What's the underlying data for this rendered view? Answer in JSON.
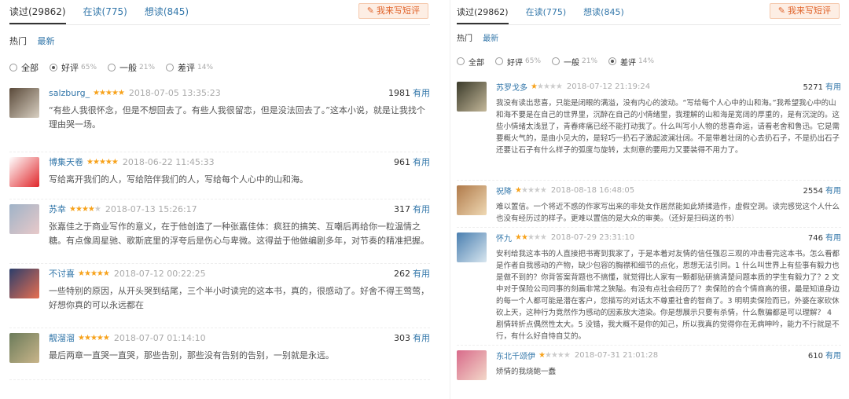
{
  "left": {
    "tabs": [
      {
        "label": "读过(29862)",
        "active": true
      },
      {
        "label": "在读(775)",
        "active": false
      },
      {
        "label": "想读(845)",
        "active": false
      }
    ],
    "write_button": "我来写短评",
    "sort": {
      "hot": "热门",
      "newest": "最新"
    },
    "filters": [
      {
        "label": "全部",
        "pct": "",
        "selected": false
      },
      {
        "label": "好评",
        "pct": "65%",
        "selected": true
      },
      {
        "label": "一般",
        "pct": "21%",
        "selected": false
      },
      {
        "label": "差评",
        "pct": "14%",
        "selected": false
      }
    ],
    "comments": [
      {
        "user": "salzburg_",
        "rating": 5,
        "date": "2018-07-05 13:35:23",
        "votes": "1981",
        "useful": "有用",
        "text": "“有些人我很怀念，但是不想回去了。有些人我很留恋，但是没法回去了。”这本小说，就是让我找个理由哭一场。",
        "avatar_colors": [
          "#5a4a3a",
          "#d9d0c2"
        ]
      },
      {
        "user": "博集天卷",
        "rating": 5,
        "date": "2018-06-22 11:45:33",
        "votes": "961",
        "useful": "有用",
        "text": "写给离开我们的人，写给陪伴我们的人，写给每个人心中的山和海。",
        "avatar_colors": [
          "#ffffff",
          "#e0262a"
        ]
      },
      {
        "user": "苏幸",
        "rating": 4,
        "date": "2018-07-13 15:26:17",
        "votes": "317",
        "useful": "有用",
        "text": "张嘉佳之于商业写作的意义，在于他创造了一种张嘉佳体：疯狂的搞笑、互嘲后再给你一粒温情之糖。有点像周星驰、歌斯底里的浮夸后是伤心与卑微。这得益于他做编剧多年，对节奏的精准把握。",
        "avatar_colors": [
          "#9fb3c8",
          "#e8c9c9"
        ]
      },
      {
        "user": "不讨喜",
        "rating": 5,
        "date": "2018-07-12 00:22:25",
        "votes": "262",
        "useful": "有用",
        "text": "一些特别的原因，从开头哭到结尾，三个半小时读完的这本书，真的，很感动了。好舍不得王莺莺，好想你真的可以永远都在",
        "avatar_colors": [
          "#2c3e6b",
          "#e76f51"
        ]
      },
      {
        "user": "靓溜溜",
        "rating": 5,
        "date": "2018-07-07 01:14:10",
        "votes": "303",
        "useful": "有用",
        "text": "最后两章一直哭一直哭，那些告别，那些没有告别的告别，一别就是永远。",
        "avatar_colors": [
          "#6b7b5a",
          "#c9b58a"
        ]
      }
    ]
  },
  "right": {
    "tabs": [
      {
        "label": "读过(29862)",
        "active": true
      },
      {
        "label": "在读(775)",
        "active": false
      },
      {
        "label": "想读(845)",
        "active": false
      }
    ],
    "write_button": "我来写短评",
    "sort": {
      "hot": "热门",
      "newest": "最新"
    },
    "filters": [
      {
        "label": "全部",
        "pct": "",
        "selected": false
      },
      {
        "label": "好评",
        "pct": "65%",
        "selected": false
      },
      {
        "label": "一般",
        "pct": "21%",
        "selected": false
      },
      {
        "label": "差评",
        "pct": "14%",
        "selected": true
      }
    ],
    "comments": [
      {
        "user": "苏罗戈多",
        "rating": 1,
        "date": "2018-07-12 21:19:24",
        "votes": "5271",
        "useful": "有用",
        "text": "我没有读出悲喜，只能是闭眼的满溢，没有内心的波动。“写给每个人心中的山和海。”我希望我心中的山和海不要是在自己的世界里，沉醉在自己的小情绪里，我理解的山和海是宽阔的厚重的，是有沉淀的。这些小情绪太浅显了，青春疼痛已经不能打动我了。什么叫写小人物的悲喜命运，请看老舍和鲁迅。它是需要概火气的，是由小见大的，是轻巧一扔石子激起波澜壮阔。不是带着壮阔的心去扔石子，不是扔出石子还要让石子有什么样子的弧度与旋转，太刻意的要用力又要装得不用力了。",
        "avatar_colors": [
          "#3a3a2a",
          "#c4b89a"
        ]
      },
      {
        "user": "祝降",
        "rating": 1,
        "date": "2018-08-18 16:48:05",
        "votes": "2554",
        "useful": "有用",
        "text": "难以置信。一个将近不惑的作家写出来的非处女作居然能如此矫揉造作，虚假空洞。读完感觉这个人什么也没有经历过的样子。更难以置信的是大众的审美。（还好是扫码送的书）",
        "avatar_colors": [
          "#b07a4a",
          "#efd9b4"
        ]
      },
      {
        "user": "怀九",
        "rating": 2,
        "date": "2018-07-29 23:31:10",
        "votes": "746",
        "useful": "有用",
        "text": "安利给我这本书的人直接把书寄到我家了，于是本着对友情的信任强忍三观的冲击看完这本书。怎么看都是作者自我感动的产物，缺少包容的胸襟和细节的点化，思想无法引同。1 什么叫世界上有些事有毅力也是做不到的？你背答案背题也不搞懂，就觉得比人家有一颗都贴研搞清楚问题本质的学生有毅力了？2 文中对于保险公司同事的刻画非常之狭隘。有没有点社会经历了？卖保险的合个情商高的很，最是知道身边的每一个人都可能是潜在客户，您描写的对话太不尊重社會的智商了。3 明明卖保险而已，外婆在家砍休砍上天，这种行为竟然作为感动的因素放大渲染。你是想展示只要有杀情，什么敷骗都是可以理解？ 4 剧情转折点偶然性太大。5 没错，我大概不是你的知己，所以我真的觉得你在无病呻吟，能力不行就是不行，有什么好自恃自艾的。",
        "avatar_colors": [
          "#4a7fb0",
          "#d8e6ef"
        ]
      },
      {
        "user": "东北千颂伊",
        "rating": 1,
        "date": "2018-07-31 21:01:28",
        "votes": "610",
        "useful": "有用",
        "text": "矫情的我烧鲍一蠢",
        "avatar_colors": [
          "#d86a8a",
          "#f3d8c9"
        ]
      }
    ]
  }
}
